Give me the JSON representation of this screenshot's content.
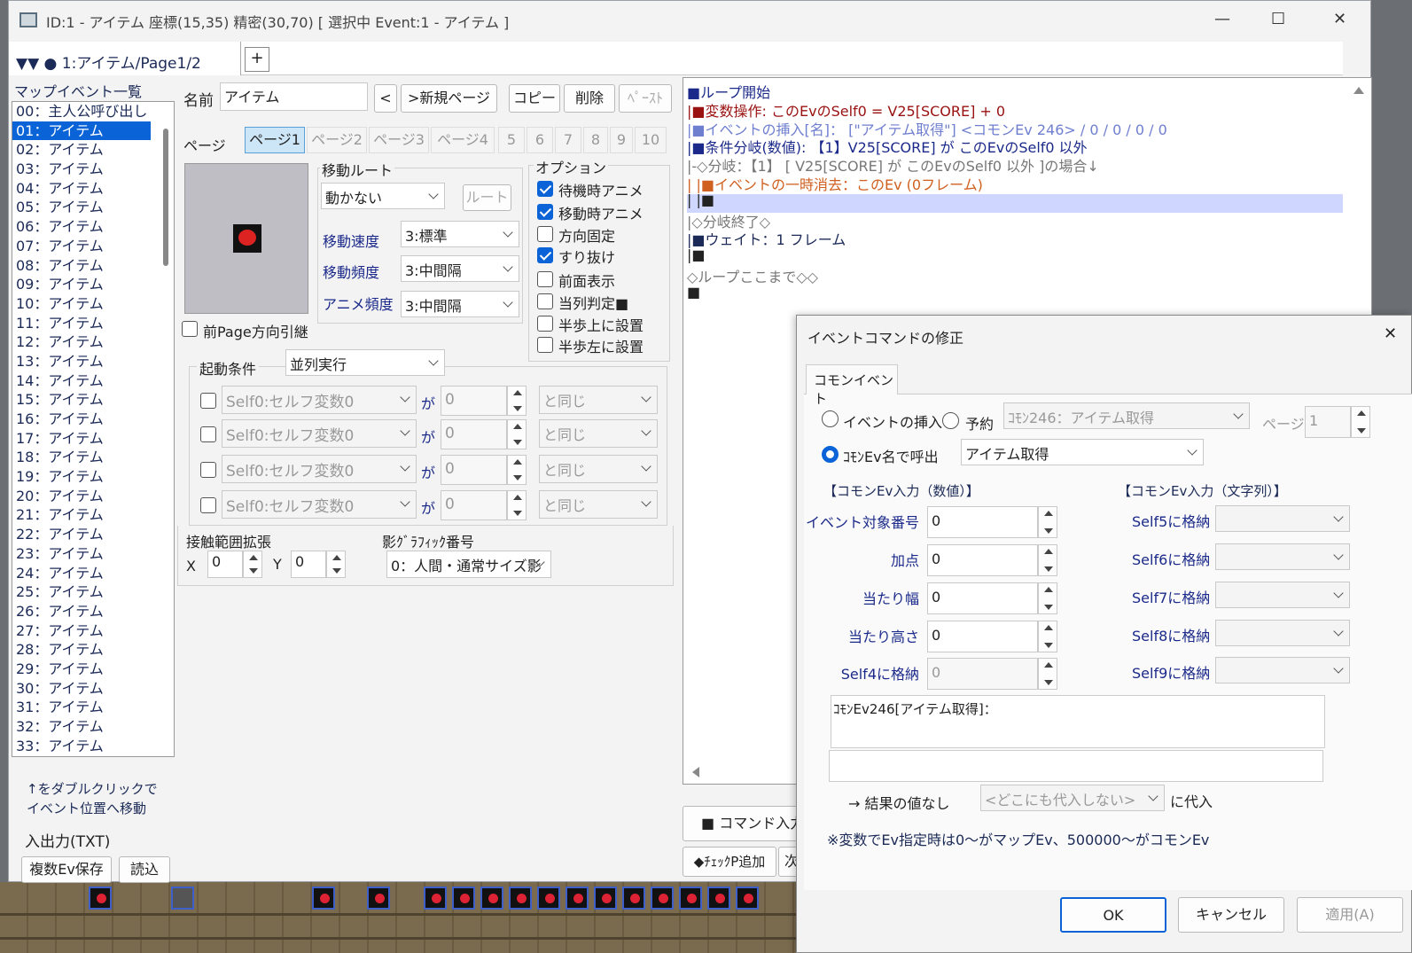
{
  "window": {
    "title": "ID:1 - アイテム 座標(15,35) 精密(30,70) [ 選択中 Event:1 - アイテム ]",
    "minimize": "—",
    "maximize": "☐",
    "close": "✕"
  },
  "tabs": {
    "active": "▼▼ ● 1:アイテム/Page1/2",
    "add": "+"
  },
  "event_list": {
    "heading": "マップイベント一覧",
    "items": [
      "00：主人公呼び出し",
      "01：アイテム",
      "02：アイテム",
      "03：アイテム",
      "04：アイテム",
      "05：アイテム",
      "06：アイテム",
      "07：アイテム",
      "08：アイテム",
      "09：アイテム",
      "10：アイテム",
      "11：アイテム",
      "12：アイテム",
      "13：アイテム",
      "14：アイテム",
      "15：アイテム",
      "16：アイテム",
      "17：アイテム",
      "18：アイテム",
      "19：アイテム",
      "20：アイテム",
      "21：アイテム",
      "22：アイテム",
      "23：アイテム",
      "24：アイテム",
      "25：アイテム",
      "26：アイテム",
      "27：アイテム",
      "28：アイテム",
      "29：アイテム",
      "30：アイテム",
      "31：アイテム",
      "32：アイテム",
      "33：アイテム"
    ],
    "selected_index": 1,
    "hint_line1": "↑をダブルクリックで",
    "hint_line2": "イベント位置へ移動",
    "io_label": "入出力(TXT)",
    "save_multi": "複数Ev保存",
    "load": "読込"
  },
  "editor": {
    "name_label": "名前",
    "name_value": "アイテム",
    "prev_btn": "<",
    "new_page_btn": ">新規ページ",
    "copy_btn": "コピー",
    "delete_btn": "削除",
    "paste_btn": "ﾍﾟｰｽﾄ",
    "page_label": "ページ",
    "page_tabs": [
      "ページ1",
      "ページ2",
      "ページ3",
      "ページ4",
      "5",
      "6",
      "7",
      "8",
      "9",
      "10"
    ],
    "move_route_label": "移動ルート",
    "move_route_value": "動かない",
    "route_btn": "ルート",
    "move_speed_label": "移動速度",
    "move_speed_value": "3:標準",
    "move_freq_label": "移動頻度",
    "move_freq_value": "3:中間隔",
    "anim_freq_label": "アニメ頻度",
    "anim_freq_value": "3:中間隔",
    "prev_page_dir": "前Page方向引継",
    "options_label": "オプション",
    "options": [
      {
        "label": "待機時アニメ",
        "checked": true
      },
      {
        "label": "移動時アニメ",
        "checked": true
      },
      {
        "label": "方向固定",
        "checked": false
      },
      {
        "label": "すり抜け",
        "checked": true
      },
      {
        "label": "前面表示",
        "checked": false
      },
      {
        "label": "当列判定■",
        "checked": false
      },
      {
        "label": "半歩上に設置",
        "checked": false
      },
      {
        "label": "半歩左に設置",
        "checked": false
      }
    ],
    "trigger_label": "起動条件",
    "trigger_value": "並列実行",
    "conditions": [
      {
        "var": "Self0:セルフ変数0",
        "ga": "が",
        "val": "0",
        "cmp": "と同じ"
      },
      {
        "var": "Self0:セルフ変数0",
        "ga": "が",
        "val": "0",
        "cmp": "と同じ"
      },
      {
        "var": "Self0:セルフ変数0",
        "ga": "が",
        "val": "0",
        "cmp": "と同じ"
      },
      {
        "var": "Self0:セルフ変数0",
        "ga": "が",
        "val": "0",
        "cmp": "と同じ"
      }
    ],
    "contact_label": "接触範囲拡張",
    "x_label": "X",
    "x_value": "0",
    "y_label": "Y",
    "y_value": "0",
    "shadow_label": "影ｸﾞﾗﾌｨｯｸ番号",
    "shadow_value": "0：人間・通常サイズ影"
  },
  "code_lines": [
    {
      "text": "■ループ開始",
      "color": "#1b2a8a"
    },
    {
      "text": "|■変数操作: このEvのSelf0 = V25[SCORE] + 0",
      "color": "#9a1111"
    },
    {
      "text": "|■イベントの挿入[名]： [\"アイテム取得\"] <コモンEv 246>  / 0 / 0 / 0 / 0",
      "color": "#6f7fd0"
    },
    {
      "text": "|■条件分岐(数値): 【1】V25[SCORE]  が   このEvのSelf0 以外",
      "color": "#1b2a8a"
    },
    {
      "text": "|-◇分岐：【1】 [ V25[SCORE]  が  このEvのSelf0 以外  ]の場合↓",
      "color": "#777"
    },
    {
      "text": "| |■イベントの一時消去：このEv (0フレーム)",
      "color": "#d06020"
    },
    {
      "text": "| |■",
      "color": "#222"
    },
    {
      "text": "|◇分岐終了◇",
      "color": "#777"
    },
    {
      "text": "|■ウェイト：1 フレーム",
      "color": "#1b2a57"
    },
    {
      "text": "|■",
      "color": "#222"
    },
    {
      "text": "◇ループここまで◇◇",
      "color": "#777"
    },
    {
      "text": "■",
      "color": "#222"
    }
  ],
  "bottom_buttons": {
    "command_input": "■  コマンド入力",
    "check_p": "◆ﾁｪｯｸP追加",
    "next": "次"
  },
  "dialog": {
    "title": "イベントコマンドの修正",
    "close": "✕",
    "tab": "コモンイベント",
    "radio_insert": "イベントの挿入",
    "radio_reserve": "予約",
    "common_select": "ｺﾓﾝ246：アイテム取得",
    "page_label": "ページ",
    "page_value": "1",
    "radio_by_name": "ｺﾓﾝEv名で呼出",
    "name_value": "アイテム取得",
    "num_input_heading": "【コモンEv入力（数値）】",
    "str_input_heading": "【コモンEv入力（文字列）】",
    "num_inputs": [
      {
        "label": "イベント対象番号",
        "value": "0",
        "enabled": true
      },
      {
        "label": "加点",
        "value": "0",
        "enabled": true
      },
      {
        "label": "当たり幅",
        "value": "0",
        "enabled": true
      },
      {
        "label": "当たり高さ",
        "value": "0",
        "enabled": true
      },
      {
        "label": "Self4に格納",
        "value": "0",
        "enabled": false
      }
    ],
    "str_inputs": [
      "Self5に格納",
      "Self6に格納",
      "Self7に格納",
      "Self8に格納",
      "Self9に格納"
    ],
    "memo_text": "ｺﾓﾝEv246[アイテム取得]：",
    "result_label": "→ 結果の値なし",
    "result_target": "<どこにも代入しない>",
    "assign_label": "に代入",
    "note": "※変数でEv指定時は0～がマップEv、500000～がコモンEv",
    "ok": "OK",
    "cancel": "キャンセル",
    "apply": "適用(A)"
  }
}
